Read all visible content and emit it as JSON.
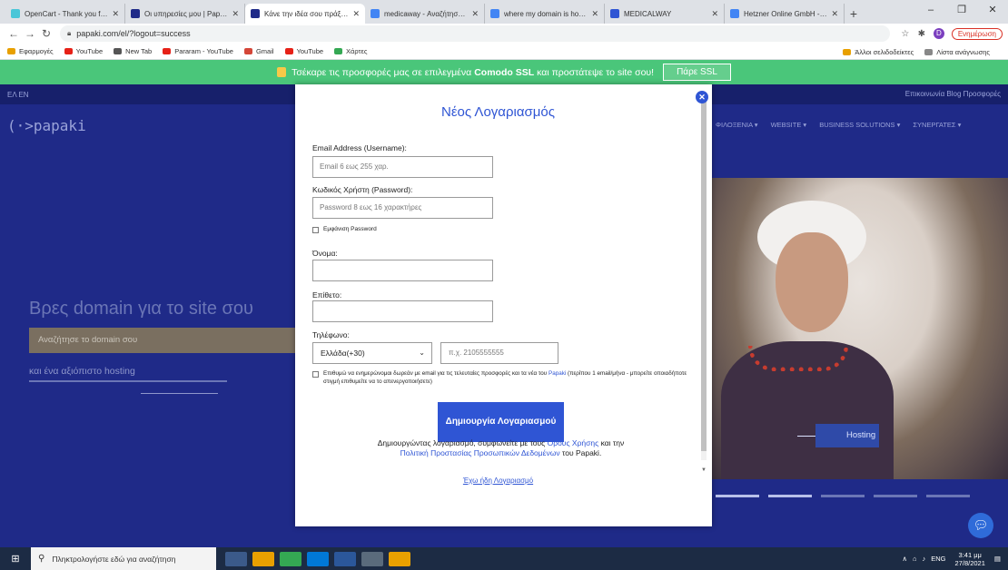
{
  "browser": {
    "tabs": [
      {
        "title": "OpenCart - Thank you for down",
        "color": "#4ac6d8"
      },
      {
        "title": "Οι υπηρεσίες μου | Papaki Control",
        "color": "#1f2a88"
      },
      {
        "title": "Κάνε την ιδέα σου πράξη με ένα",
        "color": "#1f2a88"
      },
      {
        "title": "medicaway - Αναζήτηση Google",
        "color": "#4285f4"
      },
      {
        "title": "where my domain is hosted - A",
        "color": "#4285f4"
      },
      {
        "title": "MEDICALWAY",
        "color": "#2f55d4"
      },
      {
        "title": "Hetzner Online GmbH - Αναζήτη",
        "color": "#4285f4"
      }
    ],
    "url": "papaki.com/el/?logout=success",
    "update_label": "Ενημέρωση",
    "profile_initial": "D",
    "bookmarks": [
      {
        "label": "Εφαρμογές",
        "color": "#e8a000"
      },
      {
        "label": "YouTube",
        "color": "#e62117"
      },
      {
        "label": "New Tab",
        "color": "#555555"
      },
      {
        "label": "Pararam - YouTube",
        "color": "#e62117"
      },
      {
        "label": "Gmail",
        "color": "#d44638"
      },
      {
        "label": "YouTube",
        "color": "#e62117"
      },
      {
        "label": "Χάρτες",
        "color": "#34a853"
      }
    ],
    "other_bookmarks": "Άλλοι σελιδοδείκτες",
    "reading_list": "Λίστα ανάγνωσης"
  },
  "promo": {
    "text_before": "Τσέκαρε τις προσφορές μας σε επιλεγμένα",
    "bold": "Comodo SSL",
    "text_after": "και προστάτεψε το site σου!",
    "button": "Πάρε SSL"
  },
  "site": {
    "lang": "ΕΛ  EN",
    "top_links": "Επικοινωνία  Blog  Προσφορές",
    "logo": "(·>papaki",
    "nav": [
      "ΦΙΛΟΞΕΝΙΑ ▾",
      "WEBSITE ▾",
      "BUSINESS SOLUTIONS ▾",
      "ΣΥΝΕΡΓΑΤΕΣ ▾"
    ],
    "hero_title": "Βρες domain για το site σου",
    "search_placeholder": "Αναζήτησε το domain σου",
    "hosting_tag": "και ένα αξιόπιστο hosting",
    "hosting_btn": "Hosting"
  },
  "modal": {
    "title": "Νέος Λογαριασμός",
    "email_label": "Email Address (Username):",
    "email_placeholder": "Email 6 εως 255 χαρ.",
    "password_label": "Κωδικός Χρήστη (Password):",
    "password_placeholder": "Password 8 εως 16 χαρακτήρες",
    "show_password": "Εμφάνιση Password",
    "first_name_label": "Όνομα:",
    "last_name_label": "Επίθετο:",
    "phone_label": "Τηλέφωνο:",
    "country_code": "Ελλάδα(+30)",
    "phone_placeholder": "π.χ. 2105555555",
    "consent_before": "Επιθυμώ να ενημερώνομαι δωρεάν με email για τις τελευταίες προσφορές και τα νέα του",
    "consent_link": "Papaki",
    "consent_after": "(περίπου 1 email/μήνα - μπορείτε οποιαδήποτε στιγμή επιθυμείτε να το απενεργοποιήσετε)",
    "create_button": "Δημιουργία Λογαριασμού",
    "terms_before": "Δημιουργώντας λογαριασμό, συμφωνείτε με τους",
    "terms_link": "Όρους Χρήσης",
    "terms_mid": "και την",
    "privacy_link": "Πολιτική Προστασίας Προσωπικών Δεδομένων",
    "terms_after": "του Papaki.",
    "have_account": "Έχω ήδη Λογαριασμό"
  },
  "taskbar": {
    "search_placeholder": "Πληκτρολογήστε εδώ για αναζήτηση",
    "lang": "ENG",
    "time": "3:41 μμ",
    "date": "27/8/2021",
    "apps": [
      "#3b5a8a",
      "#e8a000",
      "#34a853",
      "#0078d7",
      "#2b579a",
      "#5a6b7c",
      "#e8a000"
    ]
  }
}
